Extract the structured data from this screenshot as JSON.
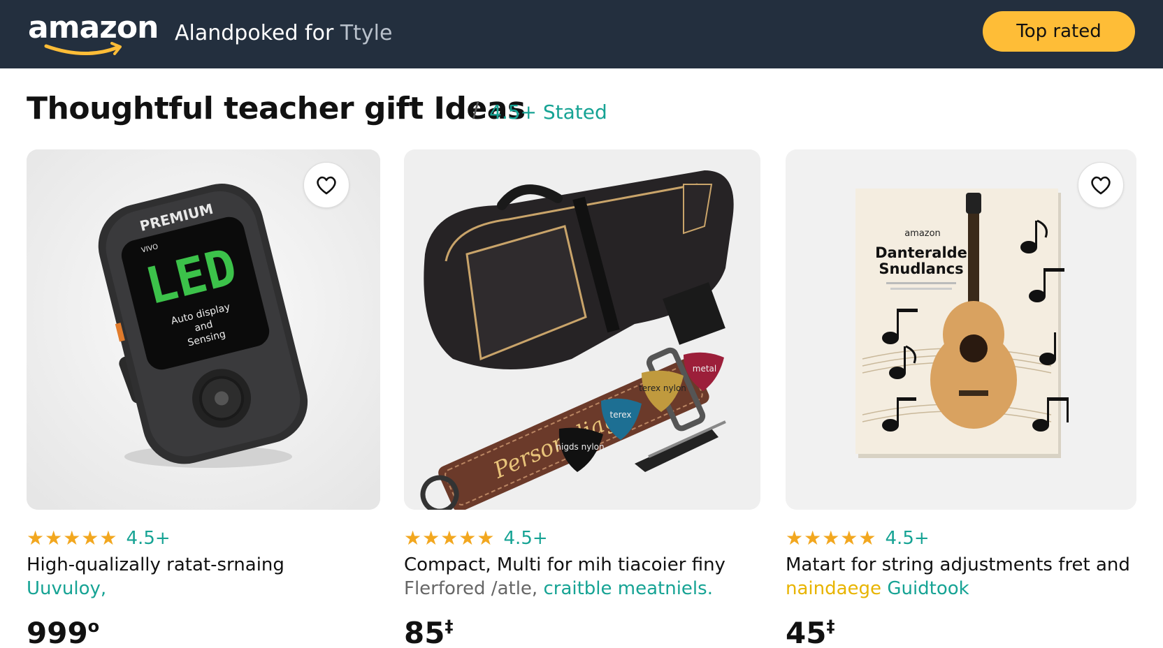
{
  "header": {
    "logo_text": "amazon",
    "tagline_main": "Alandpoked for",
    "tagline_muted": "Ttyle",
    "top_rated_label": "Top rated",
    "colors": {
      "bar": "#232f3e",
      "accent": "#febd37"
    }
  },
  "page": {
    "title": "Thoughtful teacher gift Ideas",
    "separator": "/",
    "subtitle": "4.5+ Stated"
  },
  "products": [
    {
      "image_text": {
        "brand": "PREMIUM",
        "small": "VIVO",
        "display": "LED",
        "caption_1": "Auto display",
        "caption_2": "and",
        "caption_3": "Sensing"
      },
      "stars": "★★★★★",
      "rating": "4.5+",
      "title": "High-qualizally ratat-srnaing",
      "sub_1": "Uuvuloy,",
      "price": "999",
      "price_suffix": "o",
      "favorite_icon": "heart-icon"
    },
    {
      "image_text": {
        "strap": "Personaliage",
        "pick_1": "nigds nylon",
        "pick_2": "terex",
        "pick_3": "terex nylon",
        "pick_4": "metal"
      },
      "stars": "★★★★★",
      "rating": "4.5+",
      "title": "Compact, Multi for mih tiacoier finy",
      "sub_gray": "Flerfored /atle,",
      "sub_1": "craitble meatniels.",
      "price": "85",
      "price_suffix": "‡"
    },
    {
      "image_text": {
        "brand": "amazon",
        "book_title_1": "Danteralde",
        "book_title_2": "Snudlancs"
      },
      "stars": "★★★★★",
      "rating": "4.5+",
      "title": "Matart for string adjustments fret and",
      "sub_yellow": "naindaege",
      "sub_1": "Guidtook",
      "price": "45",
      "price_suffix": "‡",
      "favorite_icon": "heart-icon"
    }
  ]
}
